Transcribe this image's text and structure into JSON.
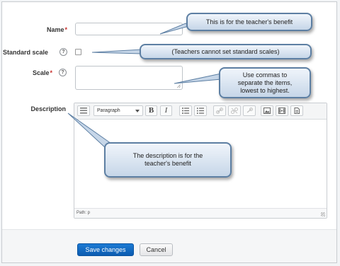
{
  "form": {
    "name": {
      "label": "Name",
      "required_mark": "*",
      "value": ""
    },
    "standard_scale": {
      "label": "Standard scale",
      "checked": false
    },
    "scale": {
      "label": "Scale",
      "required_mark": "*",
      "value": ""
    },
    "description": {
      "label": "Description",
      "value": ""
    }
  },
  "editor": {
    "paragraph_select": "Paragraph",
    "bold": "B",
    "italic": "I",
    "status_path": "Path: p"
  },
  "callouts": {
    "name_tip": "This is for the teacher's benefit",
    "standard_scale_tip": "(Teachers cannot set standard scales)",
    "scale_tip": "Use commas to separate the items, lowest to highest.",
    "description_tip": "The description is for the teacher's benefit"
  },
  "buttons": {
    "save": "Save changes",
    "cancel": "Cancel"
  },
  "help_glyph": "?",
  "colors": {
    "primary_button": "#1b7ad4",
    "required": "#c9302c",
    "callout_border": "#5d7fa3"
  }
}
